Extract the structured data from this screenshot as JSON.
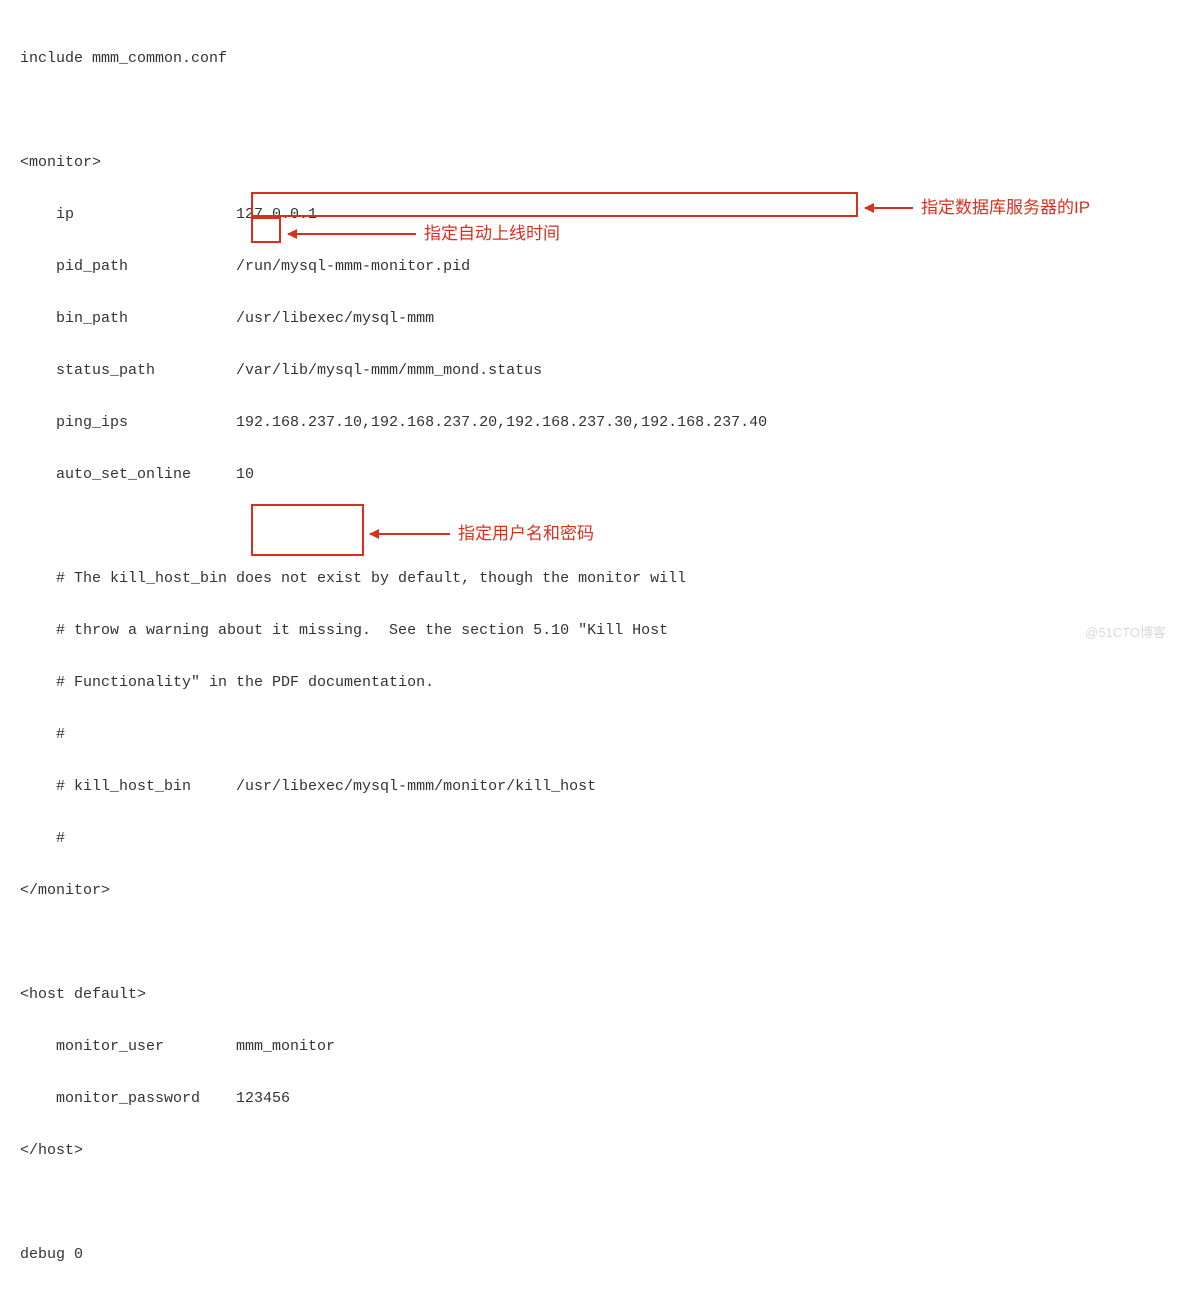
{
  "code": {
    "l1": "include mmm_common.conf",
    "l2": "",
    "l3": "<monitor>",
    "l4": "    ip                  127.0.0.1",
    "l5": "    pid_path            /run/mysql-mmm-monitor.pid",
    "l6": "    bin_path            /usr/libexec/mysql-mmm",
    "l7": "    status_path         /var/lib/mysql-mmm/mmm_mond.status",
    "l8": "    ping_ips            192.168.237.10,192.168.237.20,192.168.237.30,192.168.237.40",
    "l9": "    auto_set_online     10",
    "l10": "",
    "l11": "    # The kill_host_bin does not exist by default, though the monitor will",
    "l12": "    # throw a warning about it missing.  See the section 5.10 \"Kill Host",
    "l13": "    # Functionality\" in the PDF documentation.",
    "l14": "    #",
    "l15": "    # kill_host_bin     /usr/libexec/mysql-mmm/monitor/kill_host",
    "l16": "    #",
    "l17": "</monitor>",
    "l18": "",
    "l19": "<host default>",
    "l20": "    monitor_user        mmm_monitor",
    "l21": "    monitor_password    123456",
    "l22": "</host>",
    "l23": "",
    "l24": "debug 0"
  },
  "config_values": {
    "include": "mmm_common.conf",
    "monitor": {
      "ip": "127.0.0.1",
      "pid_path": "/run/mysql-mmm-monitor.pid",
      "bin_path": "/usr/libexec/mysql-mmm",
      "status_path": "/var/lib/mysql-mmm/mmm_mond.status",
      "ping_ips": "192.168.237.10,192.168.237.20,192.168.237.30,192.168.237.40",
      "auto_set_online": "10",
      "kill_host_bin_comment": "/usr/libexec/mysql-mmm/monitor/kill_host"
    },
    "host_default": {
      "monitor_user": "mmm_monitor",
      "monitor_password": "123456"
    },
    "debug": "0"
  },
  "annotations": {
    "ping_ips_label": "指定数据库服务器的IP",
    "auto_set_online_label": "指定自动上线时间",
    "user_pass_label": "指定用户名和密码"
  },
  "watermark": "@51CTO博客"
}
